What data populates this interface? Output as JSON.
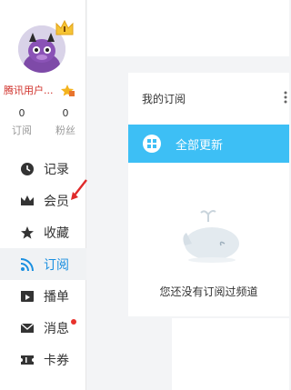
{
  "profile": {
    "username": "腾讯用户...",
    "stats": [
      {
        "num": "0",
        "label": "订阅"
      },
      {
        "num": "0",
        "label": "粉丝"
      }
    ]
  },
  "nav": [
    {
      "label": "记录",
      "icon": "clock-icon"
    },
    {
      "label": "会员",
      "icon": "crown-icon"
    },
    {
      "label": "收藏",
      "icon": "star-icon"
    },
    {
      "label": "订阅",
      "icon": "rss-icon",
      "active": true
    },
    {
      "label": "播单",
      "icon": "playlist-icon"
    },
    {
      "label": "消息",
      "icon": "mail-icon",
      "badge": "dot"
    },
    {
      "label": "卡券",
      "icon": "ticket-icon"
    }
  ],
  "subscriptions": {
    "title": "我的订阅",
    "update_all": "全部更新",
    "empty_text": "您还没有订阅过频道"
  },
  "colors": {
    "accent": "#3dbff5",
    "active_text": "#1a8fe0",
    "username": "#d0302a",
    "badge": "#e8322c"
  }
}
